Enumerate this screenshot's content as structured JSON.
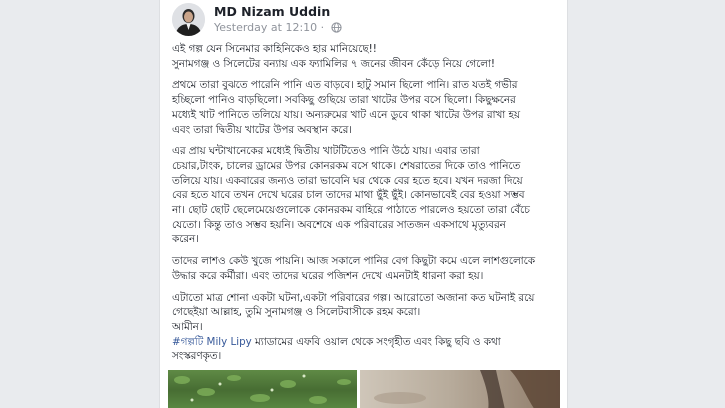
{
  "post": {
    "author": "MD Nizam Uddin",
    "timestamp": "Yesterday at 12:10",
    "separator": "·",
    "paragraphs": [
      [
        "এই গল্প যেন সিনেমার কাহিনিকেও হার মানিয়েছে!!",
        "সুনামগঞ্জ ও সিলেটের বন্যায় এক ফ্যামিলির ৭ জনের জীবন কেঁড়ে নিয়ে গেলো!"
      ],
      [
        "প্রথমে তারা বুঝতে পারেনি পানি এত বাড়বে। হাটু সমান ছিলো পানি। রাত যতই গভীর",
        "হচ্ছিলো পানিও বাড়ছিলো। সবকিছু গুছিয়ে তারা খাটের উপর বসে ছিলো। কিছুক্ষনের",
        "মধ্যেই খাট পানিতে তলিয়ে যায়। অন্যরুমের খাট এনে ডুবে থাকা খাটের উপর রাখা হয়",
        "এবং তারা দ্বিতীয় খাটের উপর অবস্থান করে।"
      ],
      [
        "এর প্রায় ঘন্টাখানেকের মধ্যেই দ্বিতীয় খাটটিতেও পানি উঠে যায়। এবার তারা",
        "চেয়ার,টাংক, চালের ড্রামের উপর কোনরকম বসে থাকে। শেষরাতের দিকে তাও পানিতে",
        "তলিয়ে যায়। একবারের জন্যও তারা ভাবেনি ঘর থেকে বের হতে হবে। যখন দরজা দিয়ে",
        "বের হতে যাবে তখন দেখে ঘরের চাল তাদের মাথা ছুঁই ছুঁই। কোনভাবেই বের হওয়া সম্ভব",
        "না। ছোট ছোট ছেলেমেয়েগুলোকে কোনরকম বাহিরে পাঠাতে পারলেও হয়তো তারা বেঁচে",
        "যেতো। কিন্তু তাও সম্ভব হয়নি। অবশেষে এক পরিবারের সাতজন একসাথে মৃত্যুবরন",
        "করেন।"
      ],
      [
        "তাদের লাশও কেউ খুজে পায়নি। আজ সকালে পানির বেগ কিছুটা কমে এলে লাশগুলোকে",
        "উদ্ধার করে কর্মীরা। এবং তাদের ঘরের পজিশন দেখে এমনটাই ধারনা করা হয়।"
      ],
      [
        "এটাতো মাত্র শোনা একটা ঘটনা,একটা পরিবারের গল্প। আরোতো অজানা কত ঘটনাই রয়ে",
        "গেছেইয়া আল্লাহ, তুমি সুনামগঞ্জ ও সিলেটবাসীকে রহম করো।",
        "আমীন।"
      ]
    ],
    "credit": {
      "hashtag": "#গল্পটি Mily Lipy",
      "line1_rest": " ম্যাডামের এফবি ওয়াল থেকে সংগৃহীত এবং কিছু ছবি ও কথা",
      "line2": "সংস্করণকৃত।"
    }
  },
  "icons": {
    "avatar": "profile-photo",
    "privacy": "globe-icon"
  },
  "colors": {
    "author": "#1d2129",
    "meta": "#90949c",
    "hashtag": "#365899",
    "background": "#e9ebee"
  }
}
